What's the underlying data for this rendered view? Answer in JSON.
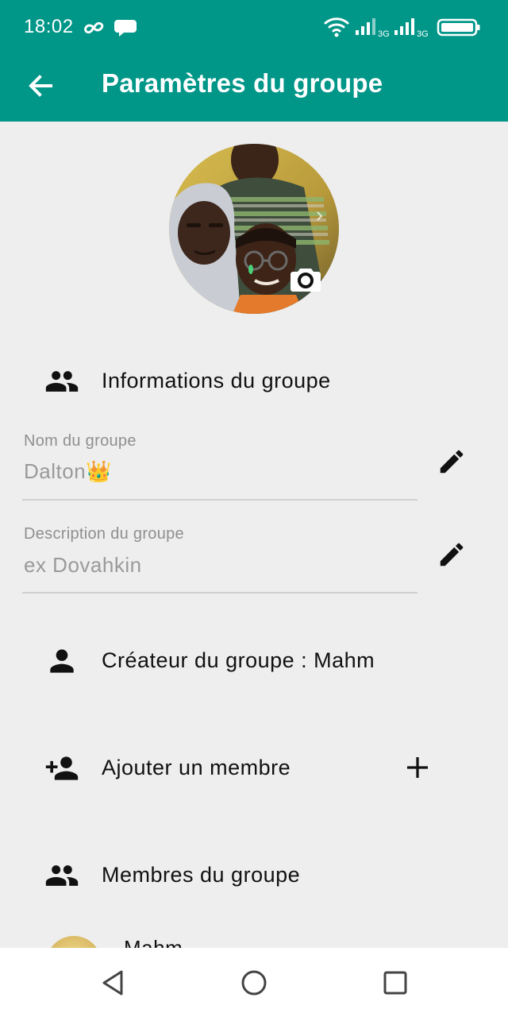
{
  "status_bar": {
    "time": "18:02",
    "left_icons": [
      "infinity-icon",
      "chat-bubble-icon"
    ],
    "right_icons": [
      "wifi-icon",
      "signal-icon",
      "signal-icon",
      "battery-icon"
    ],
    "network_1": "3G",
    "network_2": "3G"
  },
  "app_bar": {
    "title": "Paramètres du groupe",
    "color": "#009688"
  },
  "group_info": {
    "header": "Informations du groupe",
    "name_label": "Nom du groupe",
    "name_value": "Dalton👑",
    "description_label": "Description du groupe",
    "description_value": "ex Dovahkin"
  },
  "creator": {
    "label": "Créateur du groupe : Mahm"
  },
  "add_member": {
    "label": "Ajouter un membre"
  },
  "members": {
    "header": "Membres du groupe",
    "items": [
      {
        "name": "Mahm"
      }
    ]
  }
}
